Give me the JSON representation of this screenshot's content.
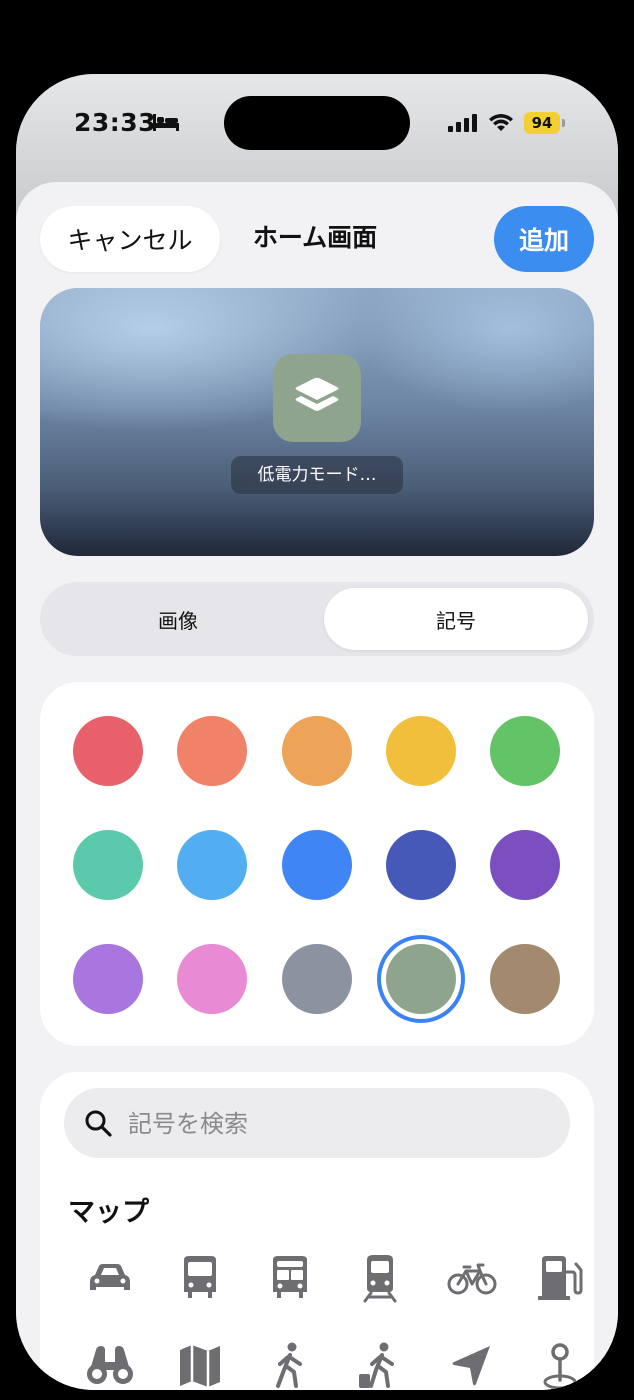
{
  "status_bar": {
    "time": "23:33",
    "battery": "94",
    "icons": [
      "bed-icon",
      "signal-icon",
      "wifi-icon",
      "battery-icon"
    ]
  },
  "header": {
    "cancel_label": "キャンセル",
    "title": "ホーム画面",
    "add_label": "追加"
  },
  "preview": {
    "app_label": "低電力モード…",
    "icon": "layers-icon",
    "icon_color": "#8fa48c"
  },
  "segment": {
    "options": [
      "画像",
      "記号"
    ],
    "selected": "記号"
  },
  "colors": {
    "swatches": [
      "#e8606a",
      "#ef8267",
      "#eda358",
      "#f2bf3d",
      "#62c466",
      "#5bc9ab",
      "#52aef0",
      "#3f86f4",
      "#4658b8",
      "#7b4fbf",
      "#a975de",
      "#e98ad4",
      "#8b93a0",
      "#8fa48c",
      "#a3896d"
    ],
    "selected_index": 13,
    "selection_ring": "#3b82f6"
  },
  "symbols": {
    "search_placeholder": "記号を検索",
    "section_title": "マップ",
    "icons": [
      "car-icon",
      "bus-icon",
      "bus-front-icon",
      "tram-icon",
      "bicycle-icon",
      "fuel-pump-icon",
      "binoculars-icon",
      "map-icon",
      "walking-person-icon",
      "person-with-luggage-icon",
      "location-arrow-icon",
      "pin-on-map-icon"
    ],
    "icon_color": "#6d6d72"
  },
  "accent": "#3b8df0"
}
